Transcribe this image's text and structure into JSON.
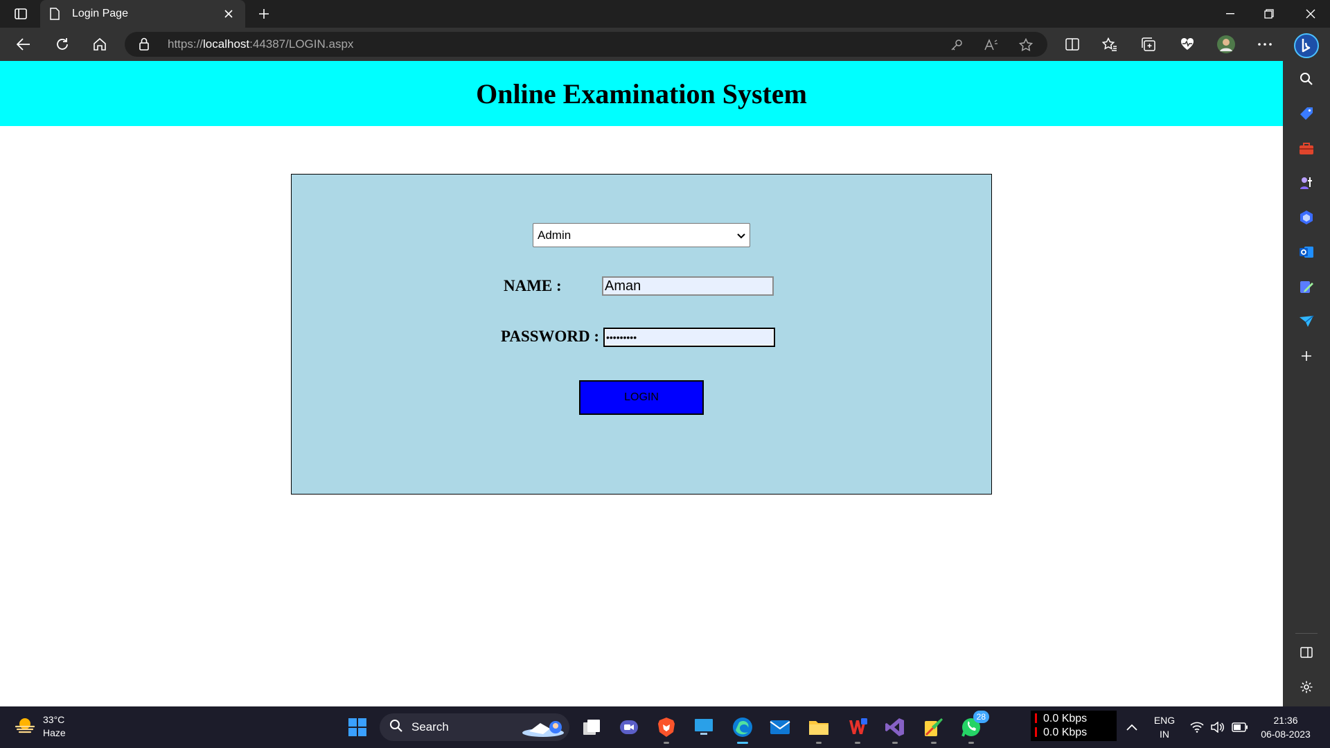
{
  "browser": {
    "tab": {
      "title": "Login Page"
    },
    "url": {
      "prefix": "https://",
      "host": "localhost",
      "rest": ":44387/LOGIN.aspx"
    }
  },
  "page": {
    "heading": "Online Examination System",
    "form": {
      "role_select": {
        "value": "Admin"
      },
      "name_label": "NAME :",
      "name_value": "Aman",
      "password_label": "PASSWORD :",
      "password_value": "•••••••••",
      "login_button": "LOGIN"
    }
  },
  "colors": {
    "header_band": "#00ffff",
    "panel": "#add8e6",
    "login_button": "#0000ff"
  },
  "taskbar": {
    "weather": {
      "temp": "33°C",
      "condition": "Haze"
    },
    "search_label": "Search",
    "whatsapp_badge": "28",
    "net": {
      "down": "0.0 Kbps",
      "up": "0.0 Kbps"
    },
    "lang": {
      "line1": "ENG",
      "line2": "IN"
    },
    "clock": {
      "time": "21:36",
      "date": "06-08-2023"
    }
  }
}
